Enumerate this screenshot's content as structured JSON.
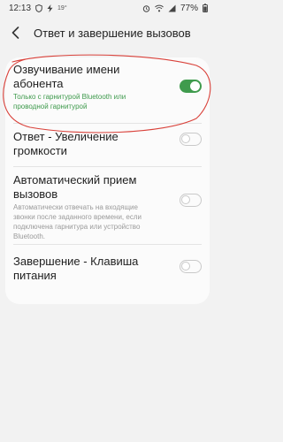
{
  "status_bar": {
    "time": "12:13",
    "temperature": "19°",
    "battery": "77%",
    "icons": [
      "shield-icon",
      "lightning-icon",
      "alarm-icon",
      "wifi-icon",
      "signal-icon",
      "battery-icon"
    ]
  },
  "header": {
    "title": "Ответ и завершение вызовов",
    "back_icon": "back-arrow-icon"
  },
  "settings": [
    {
      "title_line1": "Озвучивание имени",
      "title_line2": "абонента",
      "subtitle_line1": "Только с гарнитурой Bluetooth или",
      "subtitle_line2": "проводной гарнитурой",
      "enabled": true
    },
    {
      "title_line1": "Ответ - Увеличение",
      "title_line2": "громкости",
      "enabled": false
    },
    {
      "title_line1": "Автоматический прием",
      "title_line2": "вызовов",
      "subtitle_line1": "Автоматически отвечать на входящие",
      "subtitle_line2": "звонки после заданного времени, если",
      "subtitle_line3": "подключена гарнитура или устройство",
      "subtitle_line4": "Bluetooth.",
      "enabled": false
    },
    {
      "title_line1": "Завершение - Клавиша",
      "title_line2": "питания",
      "enabled": false
    }
  ],
  "colors": {
    "accent": "#3f9b4d",
    "annotation": "#d9413a",
    "background": "#f2f2f2",
    "card": "#fbfbfb"
  }
}
